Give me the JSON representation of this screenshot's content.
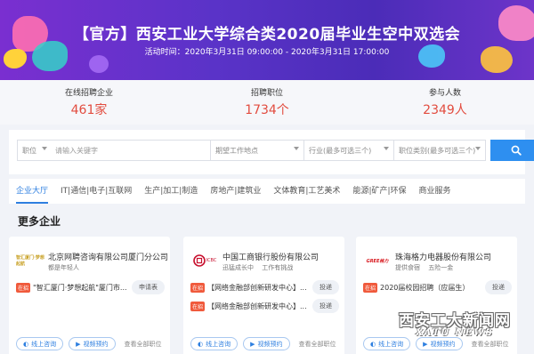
{
  "banner": {
    "title": "【官方】西安工业大学综合类2020届毕业生空中双选会",
    "time": "活动时间：2020年3月31日 09:00:00 - 2020年3月31日 17:00:00"
  },
  "stats": [
    {
      "label": "在线招聘企业",
      "value": "461家"
    },
    {
      "label": "招聘职位",
      "value": "1734个"
    },
    {
      "label": "参与人数",
      "value": "2349人"
    }
  ],
  "search": {
    "position_type": "职位",
    "keyword_placeholder": "请输入关键字",
    "location": "期望工作地点",
    "industry": "行业(最多可选三个)",
    "job_category": "职位类别(最多可选三个)"
  },
  "tabs": [
    "企业大厅",
    "IT|通信|电子|互联网",
    "生产|加工|制造",
    "房地产|建筑业",
    "文体教育|工艺美术",
    "能源|矿产|环保",
    "商业服务"
  ],
  "section_title": "更多企业",
  "cards": [
    {
      "logo_text": "智汇厦门·梦想起航",
      "company": "北京网聘咨询有限公司厦门分公司",
      "tagline": "都是年轻人",
      "jobs": [
        {
          "badge": "在招",
          "title": "\"智汇厦门·梦想起航\"厦门市...",
          "action": "申请表"
        }
      ]
    },
    {
      "logo_text": "ICBC",
      "company": "中国工商银行股份有限公司",
      "tagline": "迅猛成长中　 工作有挑战",
      "jobs": [
        {
          "badge": "在招",
          "title": "【网络金融部创新研发中心】...",
          "action": "投递"
        },
        {
          "badge": "在招",
          "title": "【网络金融部创新研发中心】...",
          "action": "投递"
        }
      ]
    },
    {
      "logo_text": "GREE格力",
      "company": "珠海格力电器股份有限公司",
      "tagline": "提供食宿　 五险一金",
      "jobs": [
        {
          "badge": "在招",
          "title": "2020届校园招聘（应届生）",
          "action": "投递"
        }
      ]
    }
  ],
  "card_actions": {
    "chat": "线上咨询",
    "video": "视频预约",
    "view_all": "查看全部职位"
  },
  "watermark": {
    "cn": "西安工大新闻网",
    "en": "XATU NEWS"
  },
  "colors": {
    "accent": "#2e7fe0",
    "stat_value": "#e24c3f",
    "hot_badge": "#f05a3c"
  }
}
